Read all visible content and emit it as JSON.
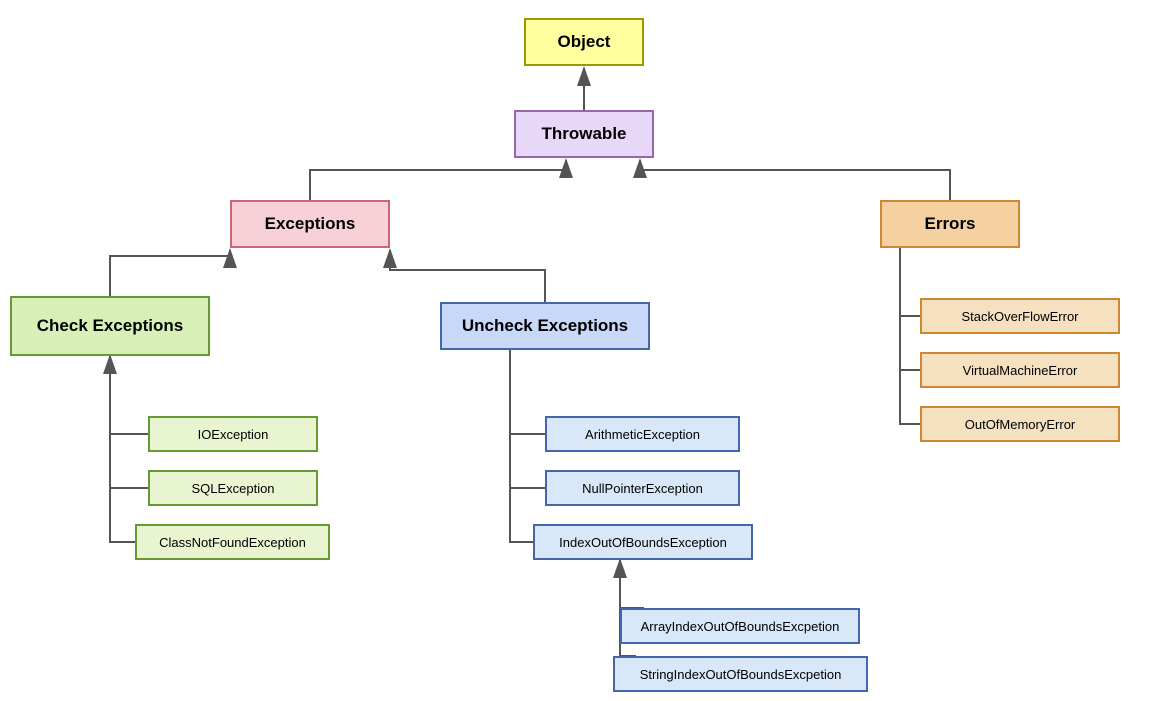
{
  "nodes": {
    "object": "Object",
    "throwable": "Throwable",
    "exceptions": "Exceptions",
    "errors": "Errors",
    "check_exceptions": "Check Exceptions",
    "uncheck_exceptions": "Uncheck Exceptions",
    "ioexception": "IOException",
    "sqlexception": "SQLException",
    "classnotfound": "ClassNotFoundException",
    "arithmetic": "ArithmeticException",
    "nullpointer": "NullPointerException",
    "indexout": "IndexOutOfBoundsException",
    "arrayindex": "ArrayIndexOutOfBoundsExcpetion",
    "stringindex": "StringIndexOutOfBoundsExcpetion",
    "stackoverflow": "StackOverFlowError",
    "virtualmachine": "VirtualMachineError",
    "outofmemory": "OutOfMemoryError"
  }
}
